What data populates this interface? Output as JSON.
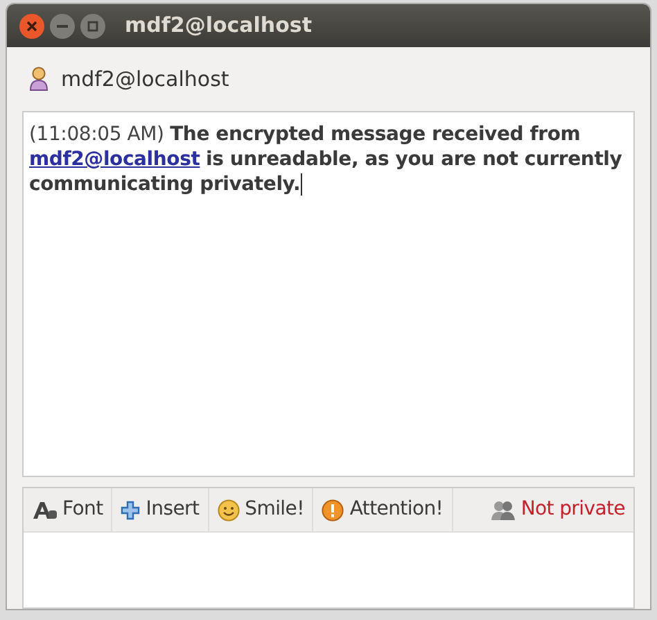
{
  "window": {
    "title": "mdf2@localhost"
  },
  "contact": {
    "name": "mdf2@localhost"
  },
  "message": {
    "timestamp": "(11:08:05 AM)",
    "text_before": "The encrypted message received from",
    "link": "mdf2@localhost",
    "text_after": "is unreadable, as you are not currently communicating privately."
  },
  "toolbar": [
    {
      "kind": "font",
      "label": "Font"
    },
    {
      "kind": "insert",
      "label": "Insert"
    },
    {
      "kind": "smile",
      "label": "Smile!"
    },
    {
      "kind": "attention",
      "label": "Attention!"
    },
    {
      "kind": "privacy",
      "label": "Not private",
      "private": false
    }
  ]
}
